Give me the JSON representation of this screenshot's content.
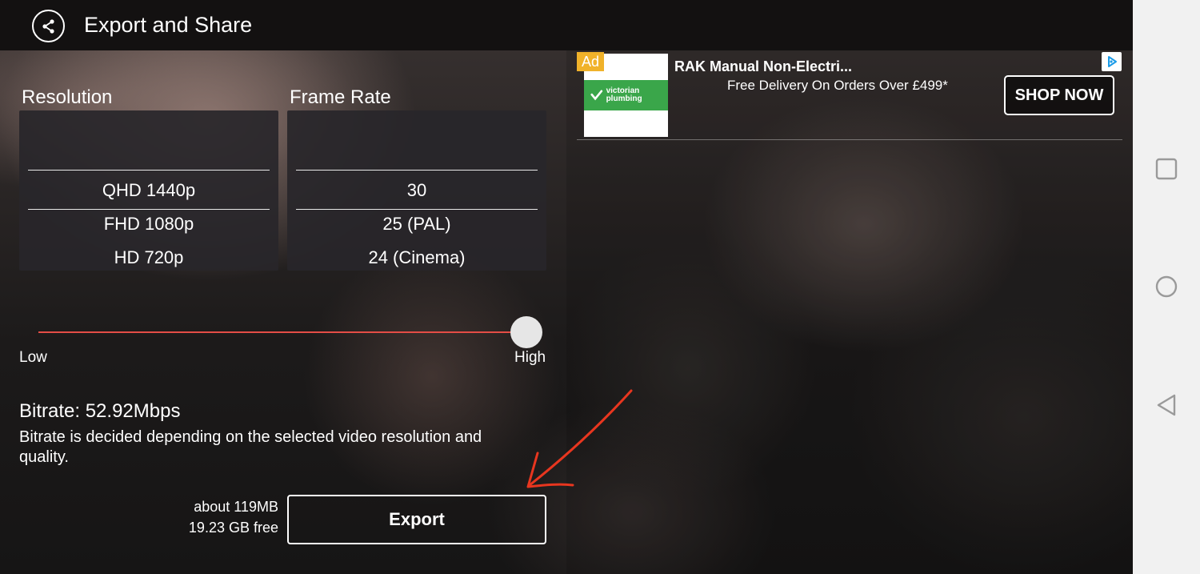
{
  "header": {
    "title": "Export and Share",
    "share_icon": "share-icon"
  },
  "resolution": {
    "label": "Resolution",
    "options": [
      "QHD 1440p",
      "FHD 1080p",
      "HD 720p"
    ],
    "selected": "QHD 1440p"
  },
  "frame_rate": {
    "label": "Frame Rate",
    "options": [
      "30",
      "25 (PAL)",
      "24 (Cinema)"
    ],
    "selected": "30"
  },
  "quality": {
    "low_label": "Low",
    "high_label": "High",
    "value": 1.0,
    "accent_color": "#e44d46"
  },
  "bitrate": {
    "value_text": "Bitrate: 52.92Mbps",
    "description": "Bitrate is decided depending on the selected video resolution and quality."
  },
  "export": {
    "size_estimate": "about 119MB",
    "free_space": "19.23 GB free",
    "button_label": "Export"
  },
  "ad": {
    "badge": "Ad",
    "badge_color": "#f0b22a",
    "logo_text": "victorian plumbing",
    "logo_color": "#3aa64a",
    "title": "RAK Manual Non-Electri...",
    "subtitle": "Free Delivery On Orders Over £499*",
    "cta_label": "SHOP NOW",
    "choices_icon": "adchoices-icon"
  },
  "system_nav": {
    "recents_icon": "square-icon",
    "home_icon": "circle-icon",
    "back_icon": "triangle-back-icon"
  }
}
